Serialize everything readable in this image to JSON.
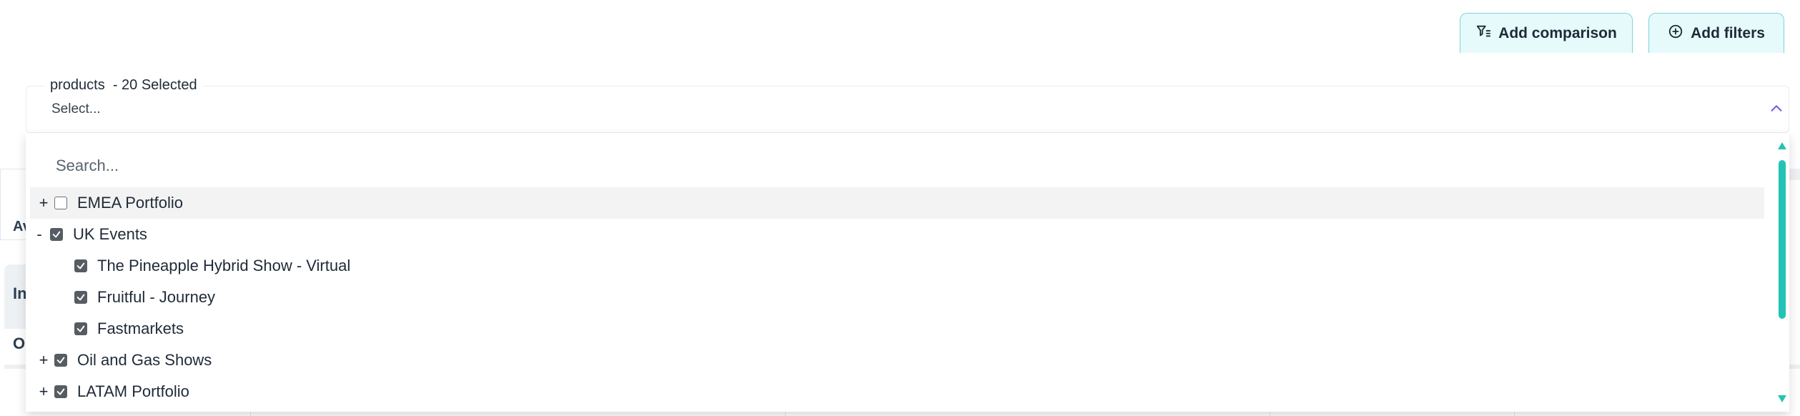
{
  "toolbar": {
    "add_comparison_label": "Add comparison",
    "add_filters_label": "Add filters"
  },
  "products_select": {
    "legend": "products  - 20 Selected",
    "placeholder": "Select..."
  },
  "dropdown": {
    "search_placeholder": "Search...",
    "items": [
      {
        "toggle": "+",
        "label": "EMEA Portfolio",
        "checked": false,
        "level": 0
      },
      {
        "toggle": "-",
        "label": "UK Events",
        "checked": true,
        "level": 0
      },
      {
        "toggle": "",
        "label": "The Pineapple Hybrid Show - Virtual",
        "checked": true,
        "level": 1
      },
      {
        "toggle": "",
        "label": "Fruitful - Journey",
        "checked": true,
        "level": 1
      },
      {
        "toggle": "",
        "label": "Fastmarkets",
        "checked": true,
        "level": 1
      },
      {
        "toggle": "+",
        "label": "Oil and Gas Shows",
        "checked": true,
        "level": 0
      },
      {
        "toggle": "+",
        "label": "LATAM Portfolio",
        "checked": true,
        "level": 0
      }
    ]
  },
  "background": {
    "fragment_1": "Av",
    "fragment_2": "In",
    "fragment_3": "O"
  },
  "colors": {
    "accent_teal": "#22c3b4",
    "button_bg": "#e6fafb",
    "button_border": "#7fd3d6",
    "checkbox_checked": "#555c63",
    "chevron": "#6c5ce7"
  },
  "icons": {
    "add_comparison": "filter-list-icon",
    "add_filters": "plus-circle-icon",
    "select_toggle": "chevron-up-icon"
  }
}
